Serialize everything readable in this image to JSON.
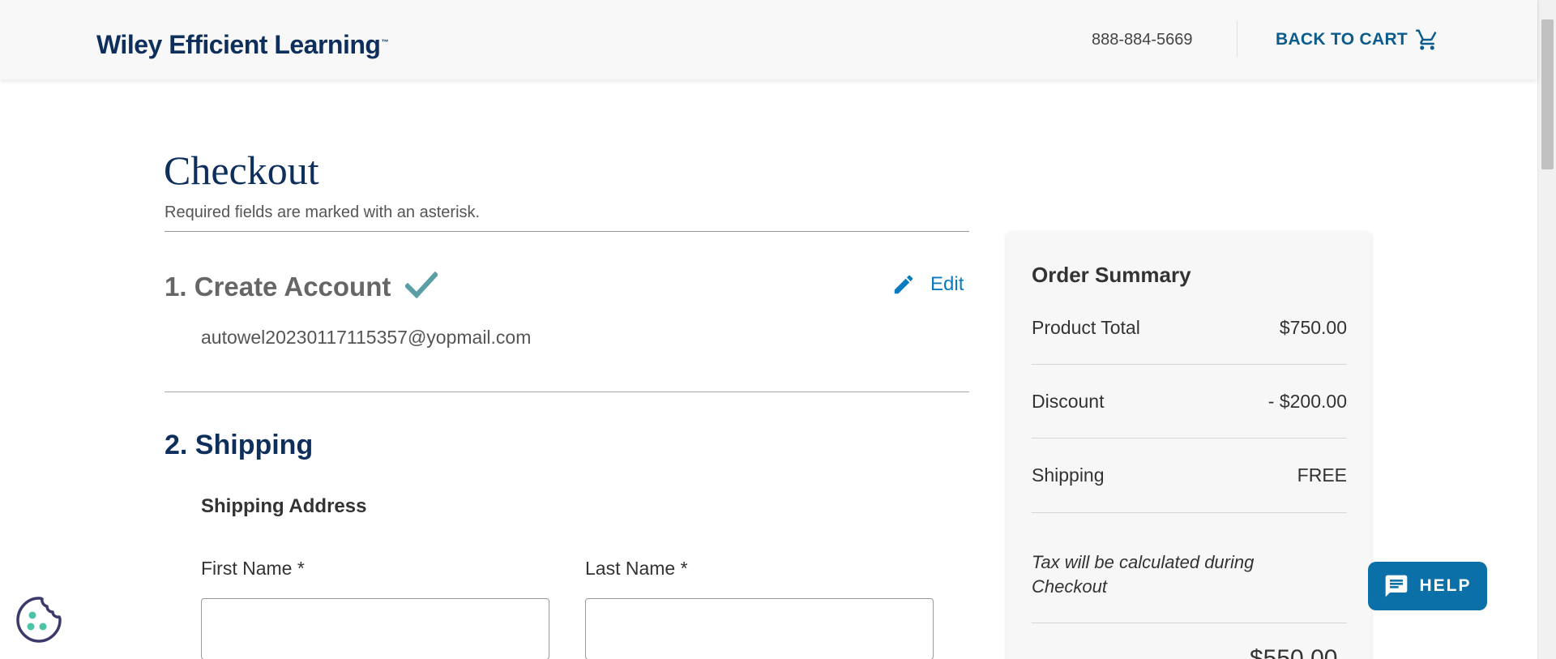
{
  "header": {
    "logo_text": "Wiley Efficient Learning",
    "logo_tm": "™",
    "phone": "888-884-5669",
    "back_to_cart": "BACK TO CART",
    "cart_icon": "shopping-cart-icon"
  },
  "checkout": {
    "title": "Checkout",
    "required_note": "Required fields are marked with an asterisk.",
    "step1": {
      "title": "1. Create Account",
      "status_icon": "checkmark-icon",
      "edit_label": "Edit",
      "edit_icon": "pencil-icon",
      "email": "autowel20230117115357@yopmail.com"
    },
    "step2": {
      "title": "2. Shipping",
      "section_heading": "Shipping Address",
      "first_name_label": "First Name *",
      "last_name_label": "Last Name *",
      "first_name_value": "",
      "last_name_value": ""
    }
  },
  "summary": {
    "title": "Order Summary",
    "rows": [
      {
        "label": "Product Total",
        "value": "$750.00"
      },
      {
        "label": "Discount",
        "value": "- $200.00"
      },
      {
        "label": "Shipping",
        "value": "FREE"
      }
    ],
    "tax_note": "Tax will be calculated during Checkout",
    "total_partial": "$550.00"
  },
  "help": {
    "label": "HELP",
    "icon": "chat-bubble-icon"
  },
  "cookie": {
    "icon": "cookie-icon"
  },
  "colors": {
    "brand_navy": "#0e2f5c",
    "link_blue": "#0b7bbf",
    "help_blue": "#0b6fa8",
    "check_teal": "#5a9fa6"
  }
}
